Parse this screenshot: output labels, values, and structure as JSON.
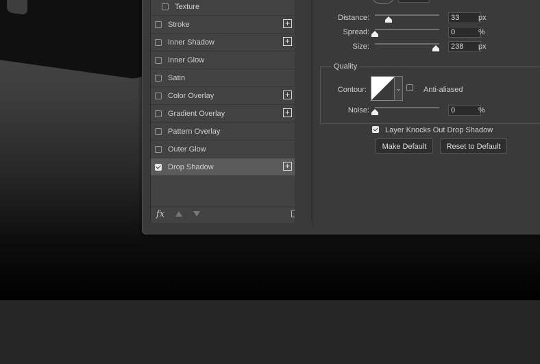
{
  "styles": [
    {
      "name": "texture",
      "label": "Texture",
      "checked": false,
      "plus": false,
      "indent": true
    },
    {
      "name": "stroke",
      "label": "Stroke",
      "checked": false,
      "plus": true
    },
    {
      "name": "inner-shadow",
      "label": "Inner Shadow",
      "checked": false,
      "plus": true
    },
    {
      "name": "inner-glow",
      "label": "Inner Glow",
      "checked": false,
      "plus": false
    },
    {
      "name": "satin",
      "label": "Satin",
      "checked": false,
      "plus": false
    },
    {
      "name": "color-overlay",
      "label": "Color Overlay",
      "checked": false,
      "plus": true
    },
    {
      "name": "gradient-overlay",
      "label": "Gradient Overlay",
      "checked": false,
      "plus": true
    },
    {
      "name": "pattern-overlay",
      "label": "Pattern Overlay",
      "checked": false,
      "plus": false
    },
    {
      "name": "outer-glow",
      "label": "Outer Glow",
      "checked": false,
      "plus": false
    },
    {
      "name": "drop-shadow",
      "label": "Drop Shadow",
      "checked": true,
      "plus": true,
      "selected": true
    }
  ],
  "footer": {
    "fx_label": "fx"
  },
  "structure": {
    "distance": {
      "label": "Distance:",
      "value": "33",
      "unit": "px",
      "fraction": 0.21
    },
    "spread": {
      "label": "Spread:",
      "value": "0",
      "unit": "%",
      "fraction": 0.0
    },
    "size": {
      "label": "Size:",
      "value": "238",
      "unit": "px",
      "fraction": 0.95
    }
  },
  "quality": {
    "title": "Quality",
    "contour_label": "Contour:",
    "anti_aliased_label": "Anti-aliased",
    "anti_aliased_checked": false,
    "noise": {
      "label": "Noise:",
      "value": "0",
      "unit": "%",
      "fraction": 0.0
    }
  },
  "layer_knocks_out": {
    "label": "Layer Knocks Out Drop Shadow",
    "checked": true
  },
  "buttons": {
    "make_default": "Make Default",
    "reset_default": "Reset to Default"
  }
}
